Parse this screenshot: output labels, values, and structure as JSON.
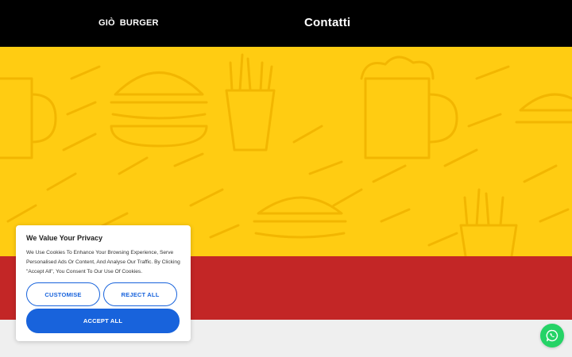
{
  "header": {
    "logo": {
      "part1": "GIÒ",
      "part2": "BURGER"
    },
    "title": "Contatti"
  },
  "colors": {
    "header_bg": "#000000",
    "hero_bg": "#ffcc12",
    "band_red": "#c32626",
    "accent_blue": "#1863dc",
    "whatsapp_green": "#25d366"
  },
  "cookie_banner": {
    "title": "We Value Your Privacy",
    "body": "We Use Cookies To Enhance Your Browsing Experience, Serve Personalised Ads Or Content, And Analyse Our Traffic. By Clicking \"Accept All\", You Consent To Our Use Of Cookies.",
    "customise_label": "CUSTOMISE",
    "reject_label": "REJECT ALL",
    "accept_label": "ACCEPT ALL"
  },
  "floating": {
    "icon": "whatsapp-icon"
  }
}
